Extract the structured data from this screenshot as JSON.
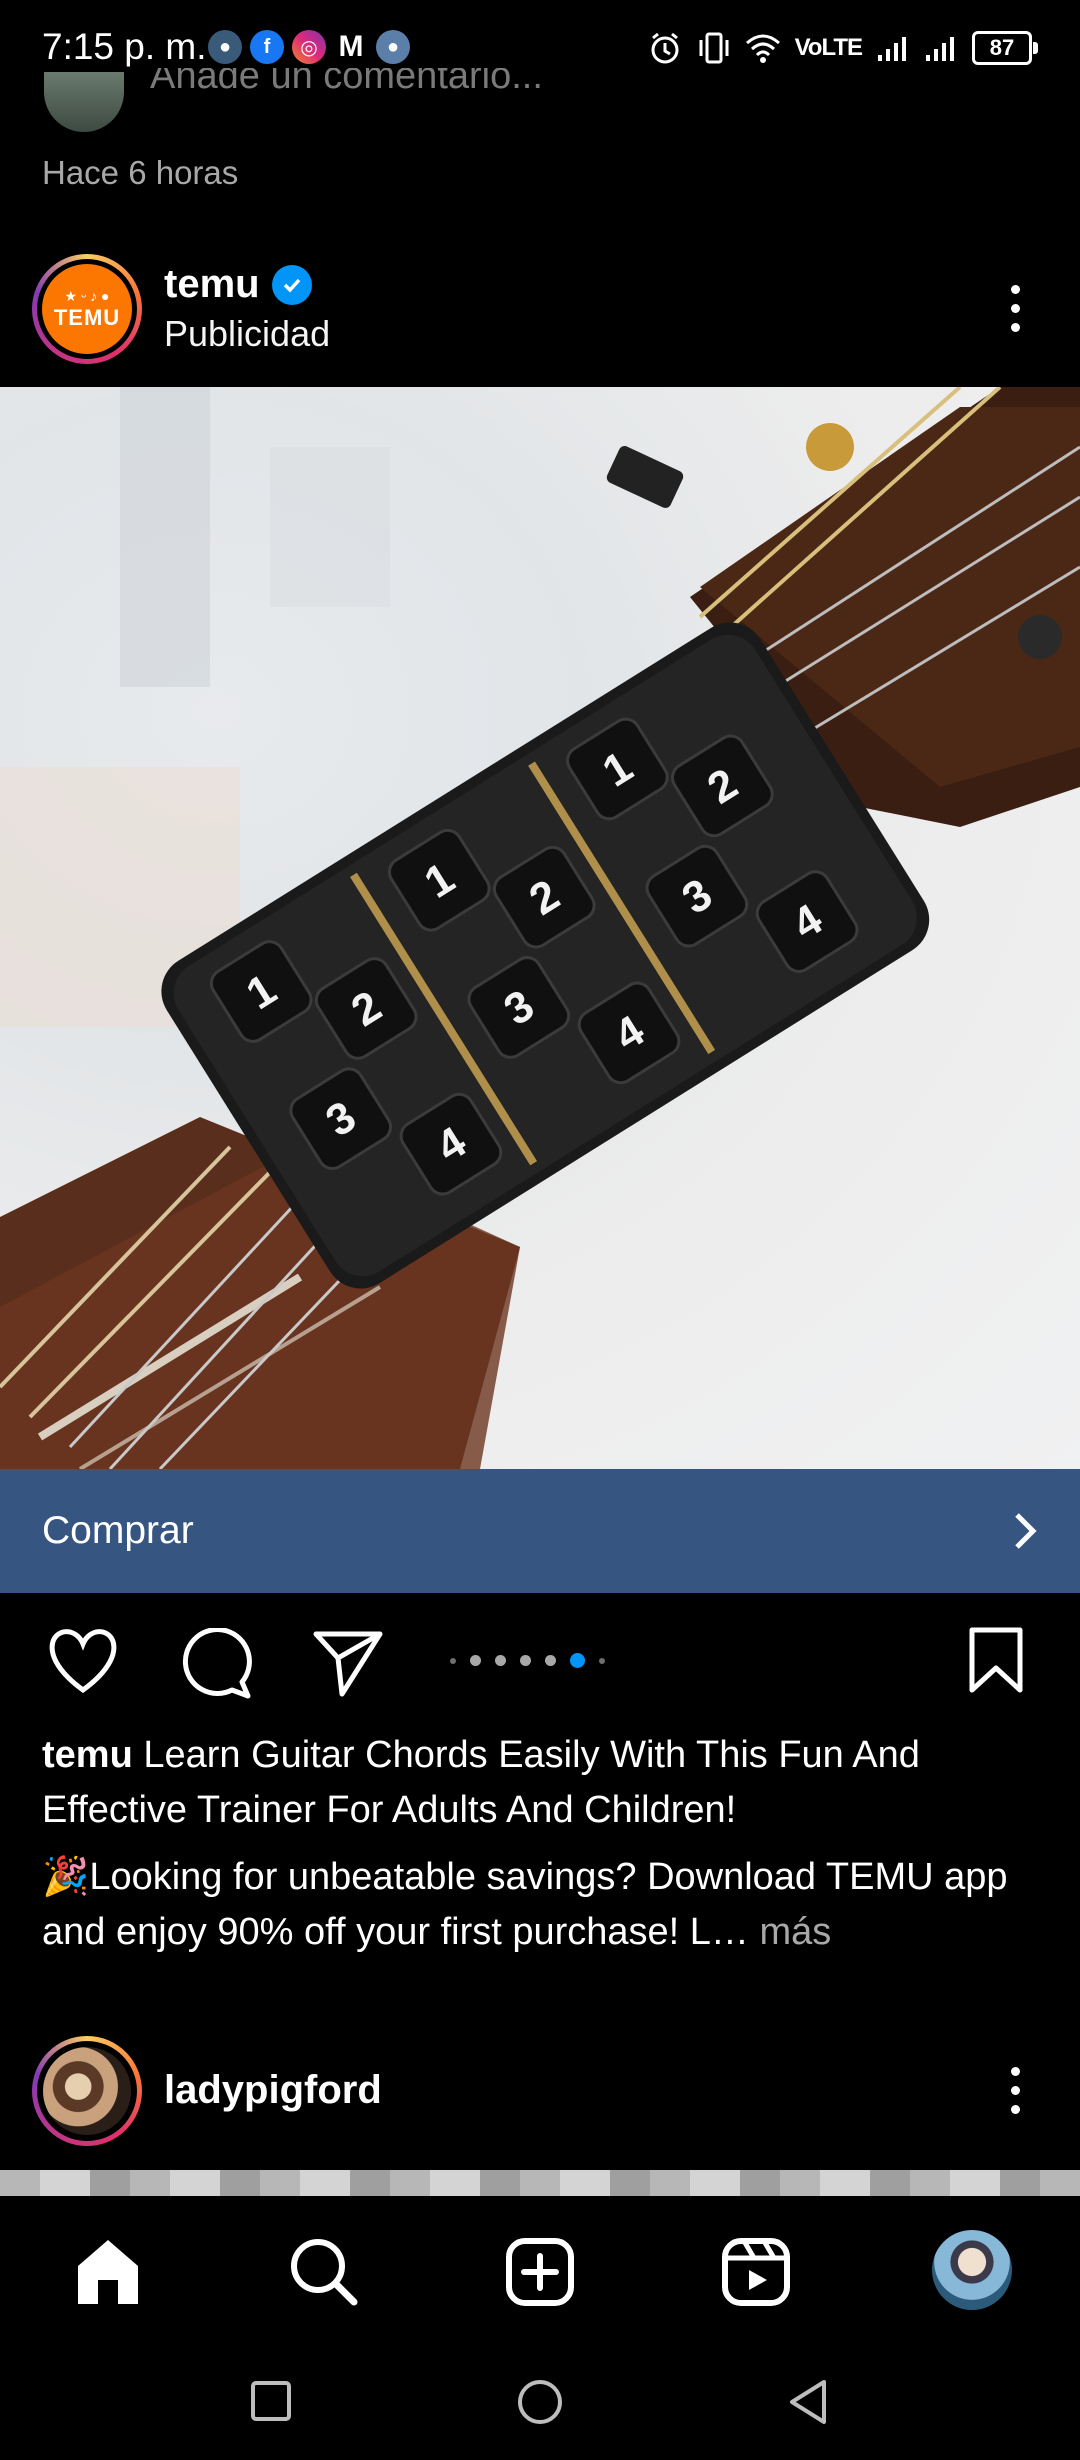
{
  "status_bar": {
    "time": "7:15 p. m.",
    "network": "VoLTE",
    "battery": "87"
  },
  "previous_post": {
    "comment_placeholder": "Añade un comentario...",
    "time_ago": "Hace 6 horas"
  },
  "post": {
    "username": "temu",
    "label": "Publicidad",
    "logo_text": "TEMU",
    "cta_label": "Comprar",
    "carousel": {
      "count": 7,
      "active_index": 5
    },
    "caption_username": "temu",
    "caption_text": "Learn Guitar Chords Easily With This Fun And Effective Trainer For Adults And Children!",
    "caption_line2_emoji": "🎉",
    "caption_line2": "Looking for unbeatable savings? Download TEMU app and enjoy 90% off your first purchase! L",
    "caption_ellipsis": "…",
    "caption_more": " más",
    "colors": {
      "cta_bg": "#375581",
      "verified": "#0095f6",
      "temu_orange": "#fb7701"
    }
  },
  "next_post": {
    "username": "ladypigford"
  },
  "nav": {
    "items": [
      "home-icon",
      "search-icon",
      "create-icon",
      "reels-icon",
      "profile-avatar"
    ]
  }
}
